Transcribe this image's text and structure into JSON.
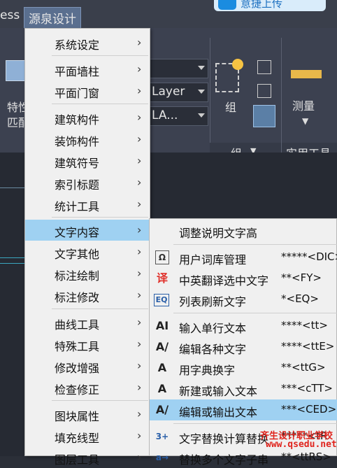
{
  "menubar": {
    "partial_left": "ess",
    "active_menu": "源泉设计",
    "cloud_button": "意捷上传"
  },
  "ribbon": {
    "combo1": "",
    "combo2": "Layer",
    "combo3": "LA...",
    "left_label_1": "特性",
    "left_label_2": "匹配",
    "group_label": "组",
    "group_panel": "组",
    "measure_label": "测量",
    "utility_panel": "实用工具"
  },
  "menu": {
    "items": [
      {
        "label": "系统设定"
      },
      {
        "label": "平面墙柱"
      },
      {
        "label": "平面门窗"
      },
      {
        "label": "建筑构件"
      },
      {
        "label": "装饰构件"
      },
      {
        "label": "建筑符号"
      },
      {
        "label": "索引标题"
      },
      {
        "label": "统计工具"
      },
      {
        "label": "文字内容"
      },
      {
        "label": "文字其他"
      },
      {
        "label": "标注绘制"
      },
      {
        "label": "标注修改"
      },
      {
        "label": "曲线工具"
      },
      {
        "label": "特殊工具"
      },
      {
        "label": "修改增强"
      },
      {
        "label": "检查修正"
      },
      {
        "label": "图块属性"
      },
      {
        "label": "填充线型"
      },
      {
        "label": "图层工具"
      }
    ]
  },
  "submenu": {
    "items": [
      {
        "label": "调整说明文字高",
        "shortcut": ""
      },
      {
        "label": "用户词库管理",
        "shortcut": "*****<DIC>"
      },
      {
        "label": "中英翻译选中文字",
        "shortcut": "**<FY>"
      },
      {
        "label": "列表刷新文字",
        "shortcut": "*<EQ>"
      },
      {
        "label": "输入单行文本",
        "shortcut": "****<tt>"
      },
      {
        "label": "编辑各种文字",
        "shortcut": "****<ttE>"
      },
      {
        "label": "用字典换字",
        "shortcut": "**<ttG>"
      },
      {
        "label": "新建或输入文本",
        "shortcut": "***<cTT>"
      },
      {
        "label": "编辑或输出文本",
        "shortcut": "***<CED>"
      },
      {
        "label": "文字替换计算替换",
        "shortcut": "*****<tR"
      },
      {
        "label": "替换多个文字子串",
        "shortcut": "**<ttRS>"
      }
    ]
  },
  "watermark": {
    "line1": "齐生设计职业学校",
    "line2": "www.qsedu.net"
  },
  "colors": {
    "highlight": "#9fd1f2",
    "menu_bg": "#f0f0f0",
    "ribbon_bg": "#3c4150"
  }
}
